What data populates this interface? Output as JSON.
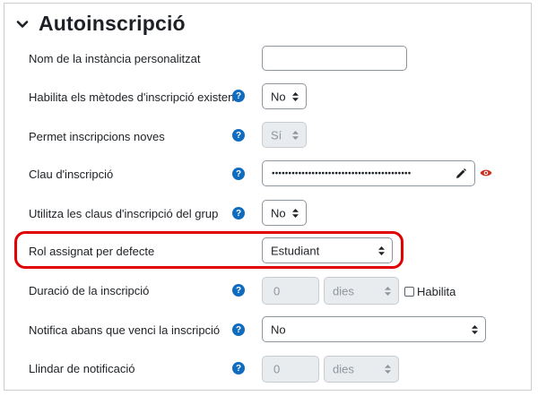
{
  "section": {
    "title": "Autoinscripció"
  },
  "fields": {
    "instance_name": {
      "label": "Nom de la instància personalitzat",
      "value": ""
    },
    "enable_existing": {
      "label": "Habilita els mètodes d'inscripció existents",
      "value": "No"
    },
    "allow_new": {
      "label": "Permet inscripcions noves",
      "value": "Sí"
    },
    "enrolment_key": {
      "label": "Clau d'inscripció",
      "masked_value": "••••••••••••••••••••••••••••••••••••••••••"
    },
    "group_keys": {
      "label": "Utilitza les claus d'inscripció del grup",
      "value": "No"
    },
    "default_role": {
      "label": "Rol assignat per defecte",
      "value": "Estudiant"
    },
    "duration": {
      "label": "Duració de la inscripció",
      "number": "0",
      "unit": "dies",
      "enable_label": "Habilita"
    },
    "notify": {
      "label": "Notifica abans que venci la inscripció",
      "value": "No"
    },
    "threshold": {
      "label": "Llindar de notificació",
      "number": "0",
      "unit": "dies"
    }
  },
  "icons": {
    "help": "question-circle-icon",
    "expand": "chevron-down-icon",
    "edit": "pencil-icon",
    "reveal": "eye-icon"
  },
  "colors": {
    "help_icon": "#0f6cbf",
    "reveal_icon": "#ca3120",
    "highlight": "#e00000",
    "disabled_bg": "#e9ecef"
  }
}
